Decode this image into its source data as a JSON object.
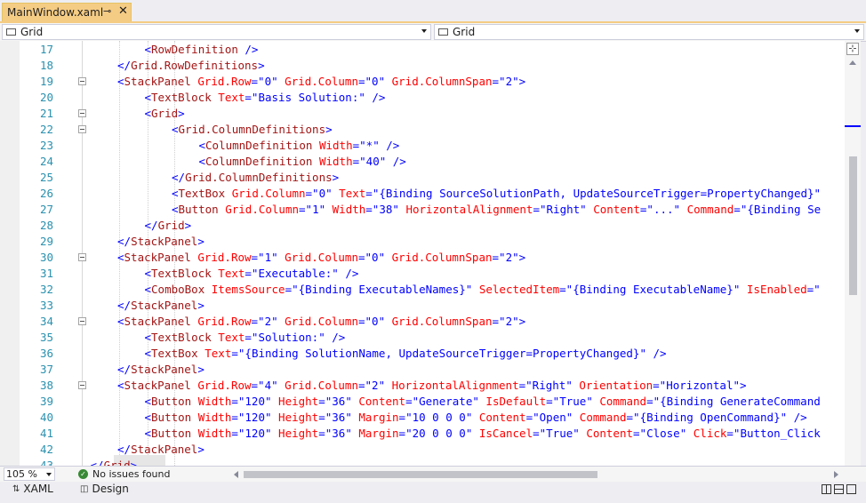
{
  "tab": {
    "title": "MainWindow.xaml",
    "pin_glyph": "⊸",
    "close_glyph": "✕"
  },
  "navbar": {
    "left": "Grid",
    "right": "Grid"
  },
  "editor": {
    "lines": [
      {
        "n": 17,
        "fold": false,
        "indent": 2,
        "tokens": [
          [
            "p",
            "<"
          ],
          [
            "t",
            "RowDefinition"
          ],
          [
            "p",
            " />"
          ]
        ]
      },
      {
        "n": 18,
        "fold": false,
        "indent": 1,
        "tokens": [
          [
            "p",
            "</"
          ],
          [
            "t",
            "Grid.RowDefinitions"
          ],
          [
            "p",
            ">"
          ]
        ]
      },
      {
        "n": 19,
        "fold": true,
        "indent": 1,
        "tokens": [
          [
            "p",
            "<"
          ],
          [
            "t",
            "StackPanel"
          ],
          [
            "a",
            " Grid.Row"
          ],
          [
            "p",
            "=\""
          ],
          [
            "v",
            "0"
          ],
          [
            "p",
            "\""
          ],
          [
            "a",
            " Grid.Column"
          ],
          [
            "p",
            "=\""
          ],
          [
            "v",
            "0"
          ],
          [
            "p",
            "\""
          ],
          [
            "a",
            " Grid.ColumnSpan"
          ],
          [
            "p",
            "=\""
          ],
          [
            "v",
            "2"
          ],
          [
            "p",
            "\">"
          ]
        ]
      },
      {
        "n": 20,
        "fold": false,
        "indent": 2,
        "tokens": [
          [
            "p",
            "<"
          ],
          [
            "t",
            "TextBlock"
          ],
          [
            "a",
            " Text"
          ],
          [
            "p",
            "=\""
          ],
          [
            "v",
            "Basis Solution:"
          ],
          [
            "p",
            "\" />"
          ]
        ]
      },
      {
        "n": 21,
        "fold": true,
        "indent": 2,
        "tokens": [
          [
            "p",
            "<"
          ],
          [
            "t",
            "Grid"
          ],
          [
            "p",
            ">"
          ]
        ]
      },
      {
        "n": 22,
        "fold": true,
        "indent": 3,
        "tokens": [
          [
            "p",
            "<"
          ],
          [
            "t",
            "Grid.ColumnDefinitions"
          ],
          [
            "p",
            ">"
          ]
        ]
      },
      {
        "n": 23,
        "fold": false,
        "indent": 4,
        "tokens": [
          [
            "p",
            "<"
          ],
          [
            "t",
            "ColumnDefinition"
          ],
          [
            "a",
            " Width"
          ],
          [
            "p",
            "=\""
          ],
          [
            "v",
            "*"
          ],
          [
            "p",
            "\" />"
          ]
        ]
      },
      {
        "n": 24,
        "fold": false,
        "indent": 4,
        "tokens": [
          [
            "p",
            "<"
          ],
          [
            "t",
            "ColumnDefinition"
          ],
          [
            "a",
            " Width"
          ],
          [
            "p",
            "=\""
          ],
          [
            "v",
            "40"
          ],
          [
            "p",
            "\" />"
          ]
        ]
      },
      {
        "n": 25,
        "fold": false,
        "indent": 3,
        "tokens": [
          [
            "p",
            "</"
          ],
          [
            "t",
            "Grid.ColumnDefinitions"
          ],
          [
            "p",
            ">"
          ]
        ]
      },
      {
        "n": 26,
        "fold": false,
        "indent": 3,
        "tokens": [
          [
            "p",
            "<"
          ],
          [
            "t",
            "TextBox"
          ],
          [
            "a",
            " Grid.Column"
          ],
          [
            "p",
            "=\""
          ],
          [
            "v",
            "0"
          ],
          [
            "p",
            "\""
          ],
          [
            "a",
            " Text"
          ],
          [
            "p",
            "=\""
          ],
          [
            "v",
            "{Binding SourceSolutionPath, UpdateSourceTrigger=PropertyChanged}"
          ],
          [
            "p",
            "\""
          ]
        ]
      },
      {
        "n": 27,
        "fold": false,
        "indent": 3,
        "tokens": [
          [
            "p",
            "<"
          ],
          [
            "t",
            "Button"
          ],
          [
            "a",
            " Grid.Column"
          ],
          [
            "p",
            "=\""
          ],
          [
            "v",
            "1"
          ],
          [
            "p",
            "\""
          ],
          [
            "a",
            " Width"
          ],
          [
            "p",
            "=\""
          ],
          [
            "v",
            "38"
          ],
          [
            "p",
            "\""
          ],
          [
            "a",
            " HorizontalAlignment"
          ],
          [
            "p",
            "=\""
          ],
          [
            "v",
            "Right"
          ],
          [
            "p",
            "\""
          ],
          [
            "a",
            " Content"
          ],
          [
            "p",
            "=\""
          ],
          [
            "v",
            "..."
          ],
          [
            "p",
            "\""
          ],
          [
            "a",
            " Command"
          ],
          [
            "p",
            "=\""
          ],
          [
            "v",
            "{Binding Se"
          ]
        ]
      },
      {
        "n": 28,
        "fold": false,
        "indent": 2,
        "tokens": [
          [
            "p",
            "</"
          ],
          [
            "t",
            "Grid"
          ],
          [
            "p",
            ">"
          ]
        ]
      },
      {
        "n": 29,
        "fold": false,
        "indent": 1,
        "tokens": [
          [
            "p",
            "</"
          ],
          [
            "t",
            "StackPanel"
          ],
          [
            "p",
            ">"
          ]
        ]
      },
      {
        "n": 30,
        "fold": true,
        "indent": 1,
        "tokens": [
          [
            "p",
            "<"
          ],
          [
            "t",
            "StackPanel"
          ],
          [
            "a",
            " Grid.Row"
          ],
          [
            "p",
            "=\""
          ],
          [
            "v",
            "1"
          ],
          [
            "p",
            "\""
          ],
          [
            "a",
            " Grid.Column"
          ],
          [
            "p",
            "=\""
          ],
          [
            "v",
            "0"
          ],
          [
            "p",
            "\""
          ],
          [
            "a",
            " Grid.ColumnSpan"
          ],
          [
            "p",
            "=\""
          ],
          [
            "v",
            "2"
          ],
          [
            "p",
            "\">"
          ]
        ]
      },
      {
        "n": 31,
        "fold": false,
        "indent": 2,
        "tokens": [
          [
            "p",
            "<"
          ],
          [
            "t",
            "TextBlock"
          ],
          [
            "a",
            " Text"
          ],
          [
            "p",
            "=\""
          ],
          [
            "v",
            "Executable:"
          ],
          [
            "p",
            "\" />"
          ]
        ]
      },
      {
        "n": 32,
        "fold": false,
        "indent": 2,
        "tokens": [
          [
            "p",
            "<"
          ],
          [
            "t",
            "ComboBox"
          ],
          [
            "a",
            " ItemsSource"
          ],
          [
            "p",
            "=\""
          ],
          [
            "v",
            "{Binding ExecutableNames}"
          ],
          [
            "p",
            "\""
          ],
          [
            "a",
            " SelectedItem"
          ],
          [
            "p",
            "=\""
          ],
          [
            "v",
            "{Binding ExecutableName}"
          ],
          [
            "p",
            "\""
          ],
          [
            "a",
            " IsEnabled"
          ],
          [
            "p",
            "=\""
          ]
        ]
      },
      {
        "n": 33,
        "fold": false,
        "indent": 1,
        "tokens": [
          [
            "p",
            "</"
          ],
          [
            "t",
            "StackPanel"
          ],
          [
            "p",
            ">"
          ]
        ]
      },
      {
        "n": 34,
        "fold": true,
        "indent": 1,
        "tokens": [
          [
            "p",
            "<"
          ],
          [
            "t",
            "StackPanel"
          ],
          [
            "a",
            " Grid.Row"
          ],
          [
            "p",
            "=\""
          ],
          [
            "v",
            "2"
          ],
          [
            "p",
            "\""
          ],
          [
            "a",
            " Grid.Column"
          ],
          [
            "p",
            "=\""
          ],
          [
            "v",
            "0"
          ],
          [
            "p",
            "\""
          ],
          [
            "a",
            " Grid.ColumnSpan"
          ],
          [
            "p",
            "=\""
          ],
          [
            "v",
            "2"
          ],
          [
            "p",
            "\">"
          ]
        ]
      },
      {
        "n": 35,
        "fold": false,
        "indent": 2,
        "tokens": [
          [
            "p",
            "<"
          ],
          [
            "t",
            "TextBlock"
          ],
          [
            "a",
            " Text"
          ],
          [
            "p",
            "=\""
          ],
          [
            "v",
            "Solution:"
          ],
          [
            "p",
            "\" />"
          ]
        ]
      },
      {
        "n": 36,
        "fold": false,
        "indent": 2,
        "tokens": [
          [
            "p",
            "<"
          ],
          [
            "t",
            "TextBox"
          ],
          [
            "a",
            " Text"
          ],
          [
            "p",
            "=\""
          ],
          [
            "v",
            "{Binding SolutionName, UpdateSourceTrigger=PropertyChanged}"
          ],
          [
            "p",
            "\" />"
          ]
        ]
      },
      {
        "n": 37,
        "fold": false,
        "indent": 1,
        "tokens": [
          [
            "p",
            "</"
          ],
          [
            "t",
            "StackPanel"
          ],
          [
            "p",
            ">"
          ]
        ]
      },
      {
        "n": 38,
        "fold": true,
        "indent": 1,
        "tokens": [
          [
            "p",
            "<"
          ],
          [
            "t",
            "StackPanel"
          ],
          [
            "a",
            " Grid.Row"
          ],
          [
            "p",
            "=\""
          ],
          [
            "v",
            "4"
          ],
          [
            "p",
            "\""
          ],
          [
            "a",
            " Grid.Column"
          ],
          [
            "p",
            "=\""
          ],
          [
            "v",
            "2"
          ],
          [
            "p",
            "\""
          ],
          [
            "a",
            " HorizontalAlignment"
          ],
          [
            "p",
            "=\""
          ],
          [
            "v",
            "Right"
          ],
          [
            "p",
            "\""
          ],
          [
            "a",
            " Orientation"
          ],
          [
            "p",
            "=\""
          ],
          [
            "v",
            "Horizontal"
          ],
          [
            "p",
            "\">"
          ]
        ]
      },
      {
        "n": 39,
        "fold": false,
        "indent": 2,
        "tokens": [
          [
            "p",
            "<"
          ],
          [
            "t",
            "Button"
          ],
          [
            "a",
            " Width"
          ],
          [
            "p",
            "=\""
          ],
          [
            "v",
            "120"
          ],
          [
            "p",
            "\""
          ],
          [
            "a",
            " Height"
          ],
          [
            "p",
            "=\""
          ],
          [
            "v",
            "36"
          ],
          [
            "p",
            "\""
          ],
          [
            "a",
            " Content"
          ],
          [
            "p",
            "=\""
          ],
          [
            "v",
            "Generate"
          ],
          [
            "p",
            "\""
          ],
          [
            "a",
            " IsDefault"
          ],
          [
            "p",
            "=\""
          ],
          [
            "v",
            "True"
          ],
          [
            "p",
            "\""
          ],
          [
            "a",
            " Command"
          ],
          [
            "p",
            "=\""
          ],
          [
            "v",
            "{Binding GenerateCommand"
          ]
        ]
      },
      {
        "n": 40,
        "fold": false,
        "indent": 2,
        "tokens": [
          [
            "p",
            "<"
          ],
          [
            "t",
            "Button"
          ],
          [
            "a",
            " Width"
          ],
          [
            "p",
            "=\""
          ],
          [
            "v",
            "120"
          ],
          [
            "p",
            "\""
          ],
          [
            "a",
            " Height"
          ],
          [
            "p",
            "=\""
          ],
          [
            "v",
            "36"
          ],
          [
            "p",
            "\""
          ],
          [
            "a",
            " Margin"
          ],
          [
            "p",
            "=\""
          ],
          [
            "v",
            "10 0 0 0"
          ],
          [
            "p",
            "\""
          ],
          [
            "a",
            " Content"
          ],
          [
            "p",
            "=\""
          ],
          [
            "v",
            "Open"
          ],
          [
            "p",
            "\""
          ],
          [
            "a",
            " Command"
          ],
          [
            "p",
            "=\""
          ],
          [
            "v",
            "{Binding OpenCommand}"
          ],
          [
            "p",
            "\" />"
          ]
        ]
      },
      {
        "n": 41,
        "fold": false,
        "indent": 2,
        "tokens": [
          [
            "p",
            "<"
          ],
          [
            "t",
            "Button"
          ],
          [
            "a",
            " Width"
          ],
          [
            "p",
            "=\""
          ],
          [
            "v",
            "120"
          ],
          [
            "p",
            "\""
          ],
          [
            "a",
            " Height"
          ],
          [
            "p",
            "=\""
          ],
          [
            "v",
            "36"
          ],
          [
            "p",
            "\""
          ],
          [
            "a",
            " Margin"
          ],
          [
            "p",
            "=\""
          ],
          [
            "v",
            "20 0 0 0"
          ],
          [
            "p",
            "\""
          ],
          [
            "a",
            " IsCancel"
          ],
          [
            "p",
            "=\""
          ],
          [
            "v",
            "True"
          ],
          [
            "p",
            "\""
          ],
          [
            "a",
            " Content"
          ],
          [
            "p",
            "=\""
          ],
          [
            "v",
            "Close"
          ],
          [
            "p",
            "\""
          ],
          [
            "a",
            " Click"
          ],
          [
            "p",
            "=\""
          ],
          [
            "v",
            "Button_Click"
          ]
        ]
      },
      {
        "n": 42,
        "fold": false,
        "indent": 1,
        "tokens": [
          [
            "p",
            "</"
          ],
          [
            "t",
            "StackPanel"
          ],
          [
            "p",
            ">"
          ]
        ]
      },
      {
        "n": 43,
        "fold": false,
        "indent": 0,
        "tokens": [
          [
            "p",
            "</"
          ],
          [
            "t",
            "Grid"
          ],
          [
            "p",
            ">"
          ]
        ]
      }
    ]
  },
  "status": {
    "zoom": "105 %",
    "issues": "No issues found",
    "ok_glyph": "✓"
  },
  "bottom_tabs": {
    "xaml": "XAML",
    "design": "Design",
    "xaml_glyph": "⇅",
    "design_glyph": "◫"
  },
  "icons": {
    "split": "⊹"
  }
}
